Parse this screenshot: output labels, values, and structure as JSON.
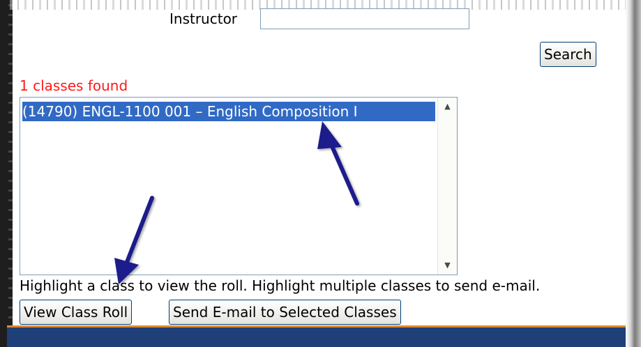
{
  "form": {
    "instructor_label": "Instructor",
    "instructor_value": "",
    "search_button": "Search"
  },
  "results": {
    "count_text": "1 classes found",
    "classes": [
      {
        "label": "(14790) ENGL-1100 001 – English Composition I",
        "selected": true
      }
    ],
    "hint": "Highlight a class to view the roll. Highlight multiple classes to send e-mail.",
    "view_roll_button": "View Class Roll",
    "send_email_button": "Send E-mail to Selected Classes"
  },
  "colors": {
    "found_text": "#ff1a1a",
    "selection": "#316ac5",
    "annotation_arrow": "#1a1f8c",
    "footer_band": "#1e3f78",
    "footer_accent": "#e08a2e"
  },
  "icons": {
    "scroll_up": "▲",
    "scroll_down": "▼"
  }
}
